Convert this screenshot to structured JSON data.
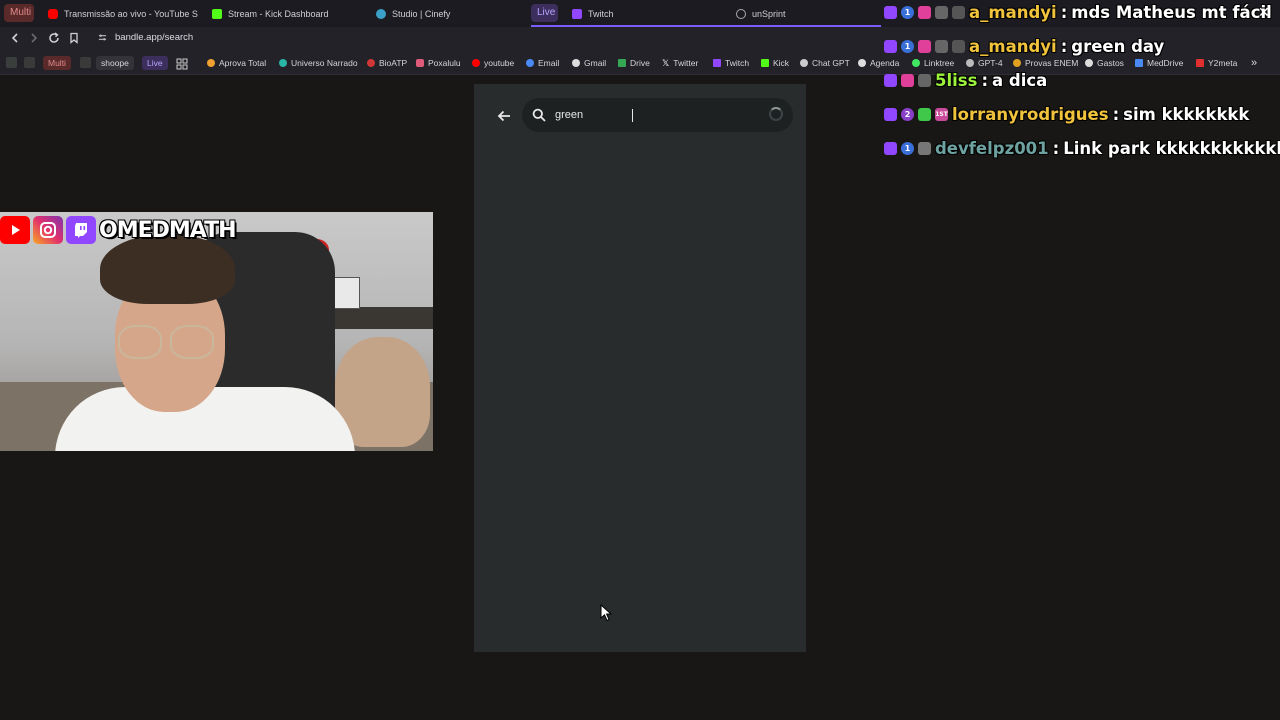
{
  "tabs": [
    {
      "label": "Transmissão ao vivo - YouTube Studio",
      "color": "#ff0000",
      "icon": "youtube-icon"
    },
    {
      "label": "Stream - Kick Dashboard",
      "color": "#53fc18",
      "icon": "kick-icon"
    },
    {
      "label": "Studio | Cinefy",
      "color": "#3aa0c8",
      "icon": "cinefy-icon"
    },
    {
      "label": "Twitch",
      "color": "#9146ff",
      "icon": "twitch-icon"
    },
    {
      "label": "unSprint",
      "color": "#aaaaaa",
      "icon": "globe-icon"
    }
  ],
  "tab_groups": {
    "multi": "Multi",
    "live": "Live"
  },
  "address_bar": {
    "url": "bandle.app/search"
  },
  "bookmarks": {
    "chips": {
      "multi": "Multi",
      "shoope": "shoope",
      "live": "Live"
    },
    "items": [
      {
        "label": "Aprova Total",
        "color": "#f0a030"
      },
      {
        "label": "Universo Narrado",
        "color": "#2ab5a5"
      },
      {
        "label": "BioATP",
        "color": "#d03838"
      },
      {
        "label": "Poxalulu",
        "color": "#e05a7a"
      },
      {
        "label": "youtube",
        "color": "#ff0000"
      },
      {
        "label": "Email",
        "color": "#4a8af4"
      },
      {
        "label": "Gmail",
        "color": "#dddddd"
      },
      {
        "label": "Drive",
        "color": "#34a853"
      },
      {
        "label": "Twitter",
        "color": "#ffffff"
      },
      {
        "label": "Twitch",
        "color": "#9146ff"
      },
      {
        "label": "Kick",
        "color": "#53fc18"
      },
      {
        "label": "Chat GPT",
        "color": "#cccccc"
      },
      {
        "label": "Agenda",
        "color": "#dddddd"
      },
      {
        "label": "Linktree",
        "color": "#43e660"
      },
      {
        "label": "GPT-4",
        "color": "#bbbbbb"
      },
      {
        "label": "Provas ENEM",
        "color": "#e0a020"
      },
      {
        "label": "Gastos",
        "color": "#dddddd"
      },
      {
        "label": "MedDrive",
        "color": "#4a8af4"
      },
      {
        "label": "Y2meta",
        "color": "#e03030"
      }
    ]
  },
  "webcam": {
    "handle": "OMEDMATH"
  },
  "bandle": {
    "search_value": "green",
    "loading": true
  },
  "chat": [
    {
      "user": "a_mandyi",
      "sep": ":",
      "message": "mds Matheus mt fácil",
      "user_color": "#f1c33c"
    },
    {
      "user": "a_mandyi",
      "sep": ":",
      "message": "green day",
      "user_color": "#f1c33c"
    },
    {
      "user": "5liss",
      "sep": ":",
      "message": "a dica",
      "user_color": "#9cf23b"
    },
    {
      "user": "lorranyrodrigues",
      "sep": ":",
      "message": "sim kkkkkkkk",
      "user_color": "#f1c33c"
    },
    {
      "user": "devfelpz001",
      "sep": ":",
      "message": "Link park kkkkkkkkkkkk",
      "user_color": "#6ea2a0"
    }
  ],
  "chat_badge_numbers": {
    "one": "1",
    "two": "2",
    "first": "1ST"
  }
}
